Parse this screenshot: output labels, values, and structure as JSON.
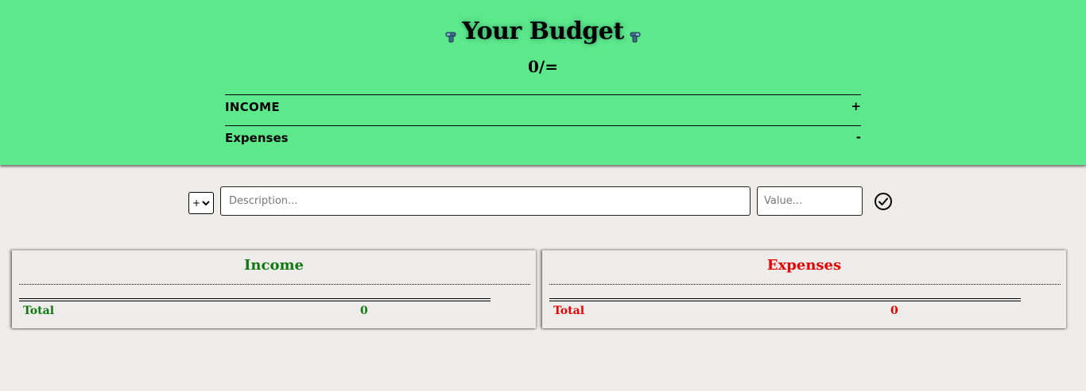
{
  "header": {
    "title": "Your Budget",
    "left_icon": "dumbbell-emoji-icon",
    "right_icon": "dumbbell-emoji-icon",
    "balance": "0/=",
    "income_label": "INCOME",
    "income_sign": "+",
    "expense_label": "Expenses",
    "expense_sign": "-",
    "background_color": "#5de88c"
  },
  "form": {
    "type_value": "+",
    "description_placeholder": "Description...",
    "value_placeholder": "Value...",
    "submit_icon": "check-circle-icon"
  },
  "income_panel": {
    "title": "Income",
    "total_label": "Total",
    "total_value": "0",
    "color": "#107a10"
  },
  "expense_panel": {
    "title": "Expenses",
    "total_label": "Total",
    "total_value": "0",
    "color": "#e60000"
  }
}
